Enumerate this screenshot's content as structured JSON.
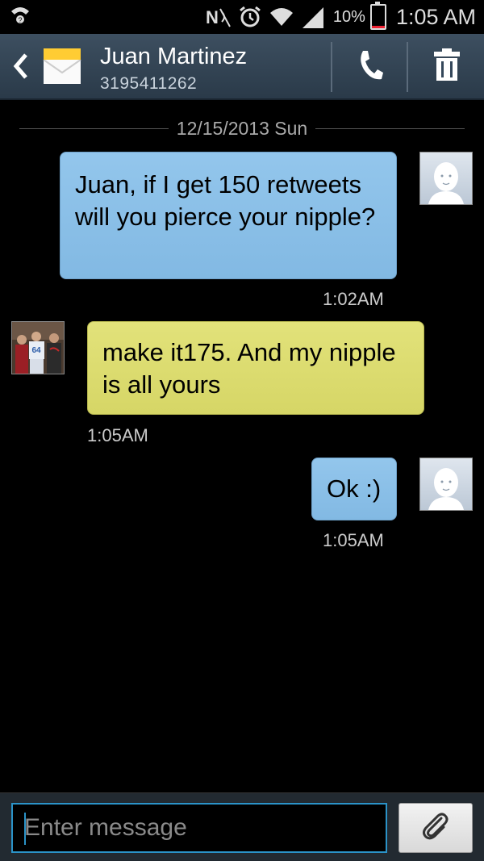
{
  "status_bar": {
    "battery_percent": "10%",
    "time": "1:05 AM"
  },
  "header": {
    "contact_name": "Juan Martinez",
    "contact_number": "3195411262"
  },
  "conversation": {
    "date_separator": "12/15/2013 Sun",
    "messages": [
      {
        "direction": "outgoing",
        "text": "Juan, if I get 150 retweets will you pierce your nipple?",
        "time": "1:02AM"
      },
      {
        "direction": "incoming",
        "text": "make it175. And my nipple is all yours",
        "time": "1:05AM"
      },
      {
        "direction": "outgoing",
        "text": "Ok :)",
        "time": "1:05AM"
      }
    ]
  },
  "composer": {
    "placeholder": "Enter message"
  },
  "colors": {
    "outgoing_bubble": "#8cc0e8",
    "incoming_bubble": "#dcdc6f",
    "action_bar": "#34475a",
    "input_border": "#2b93c8"
  }
}
